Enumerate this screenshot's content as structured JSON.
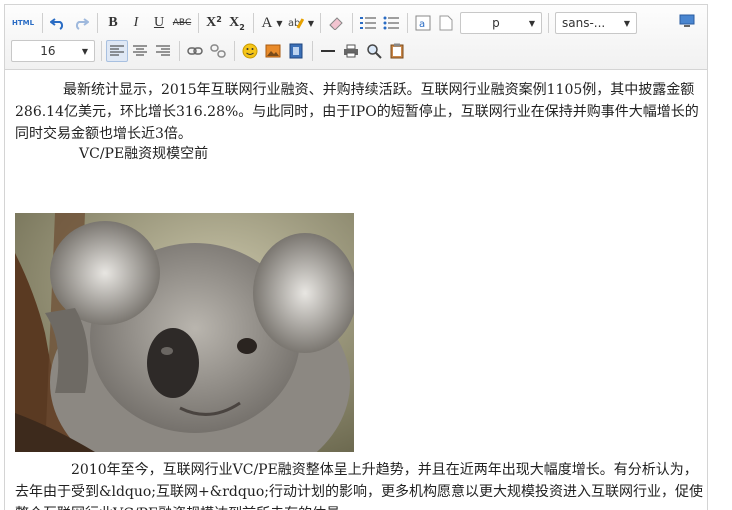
{
  "toolbar": {
    "html_label": "HTML",
    "bold_label": "B",
    "italic_label": "I",
    "underline_label": "U",
    "strike_label": "ABC",
    "superscript_label": "X",
    "superscript_mark": "2",
    "subscript_label": "X",
    "subscript_mark": "2",
    "fontcolor_label": "A",
    "paragraph_select": "p",
    "fontfamily_select": "sans-...",
    "fontsize_select": "16"
  },
  "content": {
    "paragraph1": "最新统计显示，2015年互联网行业融资、并购持续活跃。互联网行业融资案例1105例，其中披露金额286.14亿美元，环比增长316.28%。与此同时，由于IPO的短暂停止，互联网行业在保持并购事件大幅增长的同时交易金额也增长近3倍。",
    "paragraph2": "VC/PE融资规模空前",
    "paragraph3": "2010年至今，互联网行业VC/PE融资整体呈上升趋势，并且在近两年出现大幅度增长。有分析认为，去年由于受到&ldquo;互联网+&rdquo;行动计划的影响，更多机构愿意以更大规模投资进入互联网行业，促使整个互联网行业VC/PE融资规模达到前所未有的体量。"
  },
  "colors": {
    "accent_blue": "#2a6cc4",
    "toolbar_bg": "#f4f4f4",
    "active_bg": "#dfe8f5"
  }
}
